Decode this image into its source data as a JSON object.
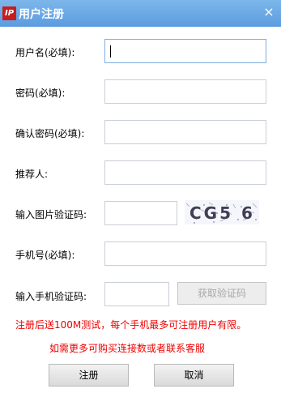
{
  "window": {
    "title": "用户注册",
    "app_icon_text": "IP",
    "close_icon": "×",
    "title_bar_color": "#5b9be0"
  },
  "form": {
    "username_label": "用户名(必填):",
    "password_label": "密码(必填):",
    "confirm_password_label": "确认密码(必填):",
    "referrer_label": "推荐人:",
    "image_captcha_label": "输入图片验证码:",
    "captcha_text": "CG5 6",
    "phone_label": "手机号(必填):",
    "sms_code_label": "输入手机验证码:",
    "get_code_button": "获取验证码"
  },
  "notices": {
    "line1": "注册后送100M测试，每个手机最多可注册用户有限。",
    "line2": "如需更多可购买连接数或者联系客服",
    "color": "#e00000"
  },
  "buttons": {
    "register": "注册",
    "cancel": "取消"
  }
}
